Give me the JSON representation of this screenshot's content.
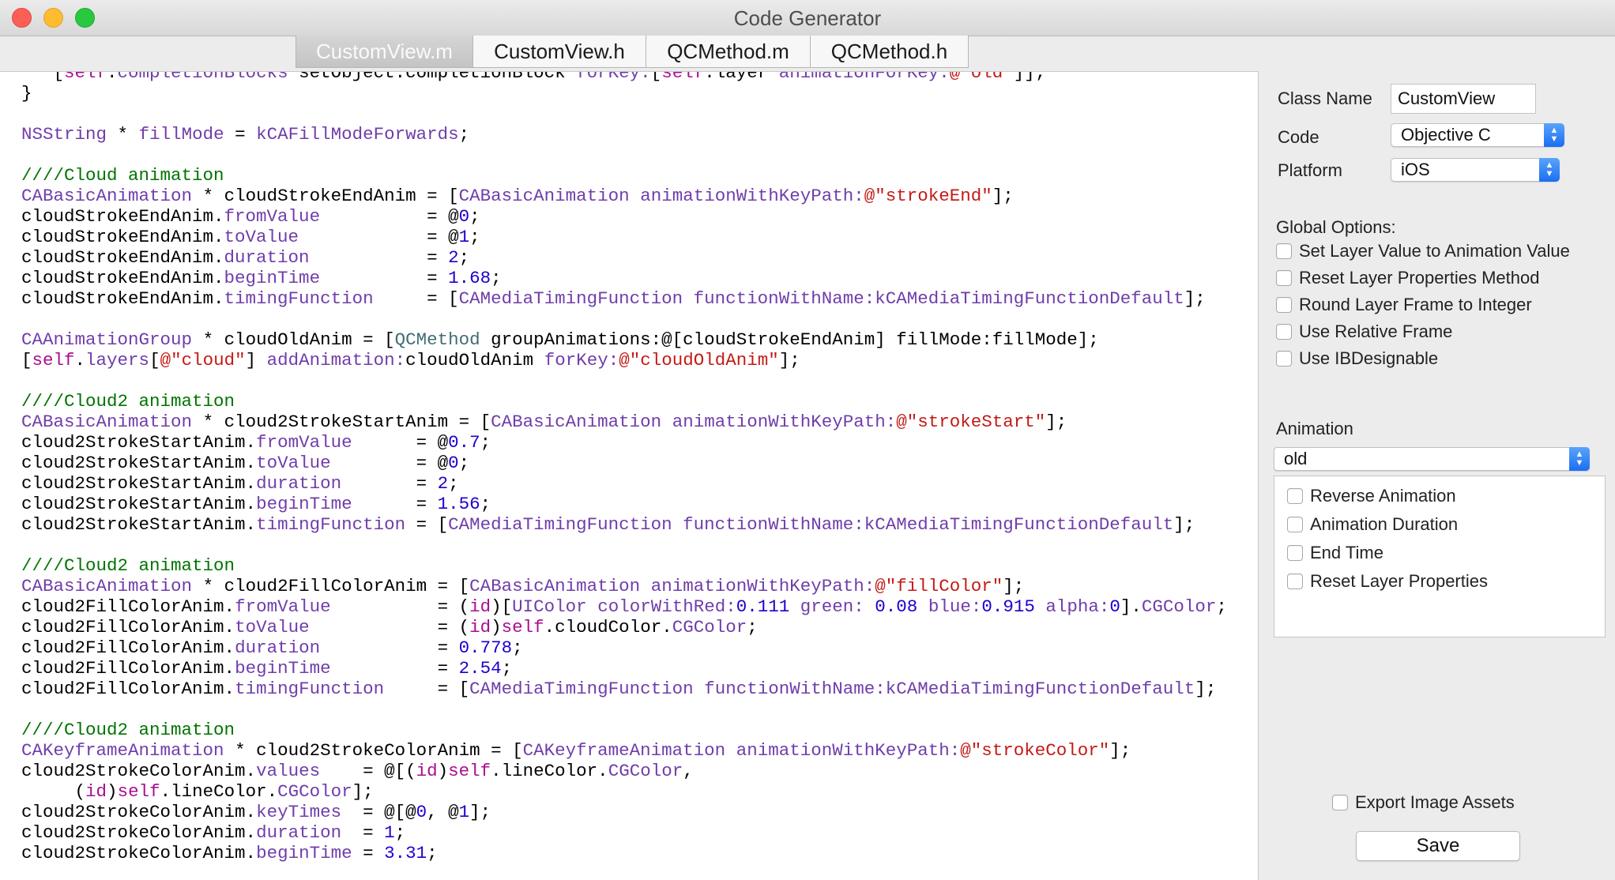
{
  "window": {
    "title": "Code Generator"
  },
  "tabs": [
    {
      "label": "CustomView.m",
      "selected": true
    },
    {
      "label": "CustomView.h",
      "selected": false
    },
    {
      "label": "QCMethod.m",
      "selected": false
    },
    {
      "label": "QCMethod.h",
      "selected": false
    }
  ],
  "code_lines": [
    [
      [
        "pln",
        "     ["
      ],
      [
        "kw",
        "self"
      ],
      [
        "pln",
        "."
      ],
      [
        "prop",
        "completionBlocks"
      ],
      [
        "pln",
        " setObject:completionBlock "
      ],
      [
        "cls",
        "forKey:"
      ],
      [
        "pln",
        "["
      ],
      [
        "kw",
        "self"
      ],
      [
        "pln",
        "."
      ],
      [
        "pln",
        "layer "
      ],
      [
        "cls",
        "animationForKey:"
      ],
      [
        "str",
        "@\"old\""
      ],
      [
        "pln",
        "]];"
      ]
    ],
    [
      [
        "pln",
        "  }"
      ]
    ],
    [
      [
        "pln",
        ""
      ]
    ],
    [
      [
        "pln",
        "  "
      ],
      [
        "cls",
        "NSString"
      ],
      [
        "pln",
        " * "
      ],
      [
        "cls",
        "fillMode"
      ],
      [
        "pln",
        " = "
      ],
      [
        "cls",
        "kCAFillModeForwards"
      ],
      [
        "pln",
        ";"
      ]
    ],
    [
      [
        "pln",
        ""
      ]
    ],
    [
      [
        "pln",
        "  "
      ],
      [
        "cmt",
        "////Cloud animation"
      ]
    ],
    [
      [
        "pln",
        "  "
      ],
      [
        "cls",
        "CABasicAnimation"
      ],
      [
        "pln",
        " * cloudStrokeEndAnim = ["
      ],
      [
        "cls",
        "CABasicAnimation"
      ],
      [
        "pln",
        " "
      ],
      [
        "cls",
        "animationWithKeyPath:"
      ],
      [
        "str",
        "@\"strokeEnd\""
      ],
      [
        "pln",
        "];"
      ]
    ],
    [
      [
        "pln",
        "  cloudStrokeEndAnim."
      ],
      [
        "prop",
        "fromValue"
      ],
      [
        "pln",
        "          = @"
      ],
      [
        "num",
        "0"
      ],
      [
        "pln",
        ";"
      ]
    ],
    [
      [
        "pln",
        "  cloudStrokeEndAnim."
      ],
      [
        "prop",
        "toValue"
      ],
      [
        "pln",
        "            = @"
      ],
      [
        "num",
        "1"
      ],
      [
        "pln",
        ";"
      ]
    ],
    [
      [
        "pln",
        "  cloudStrokeEndAnim."
      ],
      [
        "prop",
        "duration"
      ],
      [
        "pln",
        "           = "
      ],
      [
        "num",
        "2"
      ],
      [
        "pln",
        ";"
      ]
    ],
    [
      [
        "pln",
        "  cloudStrokeEndAnim."
      ],
      [
        "prop",
        "beginTime"
      ],
      [
        "pln",
        "          = "
      ],
      [
        "num",
        "1.68"
      ],
      [
        "pln",
        ";"
      ]
    ],
    [
      [
        "pln",
        "  cloudStrokeEndAnim."
      ],
      [
        "prop",
        "timingFunction"
      ],
      [
        "pln",
        "     = ["
      ],
      [
        "cls",
        "CAMediaTimingFunction"
      ],
      [
        "pln",
        " "
      ],
      [
        "cls",
        "functionWithName:"
      ],
      [
        "cls",
        "kCAMediaTimingFunctionDefault"
      ],
      [
        "pln",
        "];"
      ]
    ],
    [
      [
        "pln",
        ""
      ]
    ],
    [
      [
        "pln",
        "  "
      ],
      [
        "cls",
        "CAAnimationGroup"
      ],
      [
        "pln",
        " * cloudOldAnim = ["
      ],
      [
        "qc",
        "QCMethod"
      ],
      [
        "pln",
        " groupAnimations:@[cloudStrokeEndAnim] fillMode:fillMode];"
      ]
    ],
    [
      [
        "pln",
        "  ["
      ],
      [
        "kw",
        "self"
      ],
      [
        "pln",
        "."
      ],
      [
        "prop",
        "layers"
      ],
      [
        "pln",
        "["
      ],
      [
        "str",
        "@\"cloud\""
      ],
      [
        "pln",
        "] "
      ],
      [
        "cls",
        "addAnimation:"
      ],
      [
        "pln",
        "cloudOldAnim "
      ],
      [
        "cls",
        "forKey:"
      ],
      [
        "str",
        "@\"cloudOldAnim\""
      ],
      [
        "pln",
        "];"
      ]
    ],
    [
      [
        "pln",
        ""
      ]
    ],
    [
      [
        "pln",
        "  "
      ],
      [
        "cmt",
        "////Cloud2 animation"
      ]
    ],
    [
      [
        "pln",
        "  "
      ],
      [
        "cls",
        "CABasicAnimation"
      ],
      [
        "pln",
        " * cloud2StrokeStartAnim = ["
      ],
      [
        "cls",
        "CABasicAnimation"
      ],
      [
        "pln",
        " "
      ],
      [
        "cls",
        "animationWithKeyPath:"
      ],
      [
        "str",
        "@\"strokeStart\""
      ],
      [
        "pln",
        "];"
      ]
    ],
    [
      [
        "pln",
        "  cloud2StrokeStartAnim."
      ],
      [
        "prop",
        "fromValue"
      ],
      [
        "pln",
        "      = @"
      ],
      [
        "num",
        "0.7"
      ],
      [
        "pln",
        ";"
      ]
    ],
    [
      [
        "pln",
        "  cloud2StrokeStartAnim."
      ],
      [
        "prop",
        "toValue"
      ],
      [
        "pln",
        "        = @"
      ],
      [
        "num",
        "0"
      ],
      [
        "pln",
        ";"
      ]
    ],
    [
      [
        "pln",
        "  cloud2StrokeStartAnim."
      ],
      [
        "prop",
        "duration"
      ],
      [
        "pln",
        "       = "
      ],
      [
        "num",
        "2"
      ],
      [
        "pln",
        ";"
      ]
    ],
    [
      [
        "pln",
        "  cloud2StrokeStartAnim."
      ],
      [
        "prop",
        "beginTime"
      ],
      [
        "pln",
        "      = "
      ],
      [
        "num",
        "1.56"
      ],
      [
        "pln",
        ";"
      ]
    ],
    [
      [
        "pln",
        "  cloud2StrokeStartAnim."
      ],
      [
        "prop",
        "timingFunction"
      ],
      [
        "pln",
        " = ["
      ],
      [
        "cls",
        "CAMediaTimingFunction"
      ],
      [
        "pln",
        " "
      ],
      [
        "cls",
        "functionWithName:"
      ],
      [
        "cls",
        "kCAMediaTimingFunctionDefault"
      ],
      [
        "pln",
        "];"
      ]
    ],
    [
      [
        "pln",
        ""
      ]
    ],
    [
      [
        "pln",
        "  "
      ],
      [
        "cmt",
        "////Cloud2 animation"
      ]
    ],
    [
      [
        "pln",
        "  "
      ],
      [
        "cls",
        "CABasicAnimation"
      ],
      [
        "pln",
        " * cloud2FillColorAnim = ["
      ],
      [
        "cls",
        "CABasicAnimation"
      ],
      [
        "pln",
        " "
      ],
      [
        "cls",
        "animationWithKeyPath:"
      ],
      [
        "str",
        "@\"fillColor\""
      ],
      [
        "pln",
        "];"
      ]
    ],
    [
      [
        "pln",
        "  cloud2FillColorAnim."
      ],
      [
        "prop",
        "fromValue"
      ],
      [
        "pln",
        "          = ("
      ],
      [
        "kw",
        "id"
      ],
      [
        "pln",
        ")["
      ],
      [
        "cls",
        "UIColor"
      ],
      [
        "pln",
        " "
      ],
      [
        "cls",
        "colorWithRed:"
      ],
      [
        "num",
        "0.111"
      ],
      [
        "pln",
        " "
      ],
      [
        "cls",
        "green:"
      ],
      [
        "pln",
        " "
      ],
      [
        "num",
        "0.08"
      ],
      [
        "pln",
        " "
      ],
      [
        "cls",
        "blue:"
      ],
      [
        "num",
        "0.915"
      ],
      [
        "pln",
        " "
      ],
      [
        "cls",
        "alpha:"
      ],
      [
        "num",
        "0"
      ],
      [
        "pln",
        "]."
      ],
      [
        "prop",
        "CGColor"
      ],
      [
        "pln",
        ";"
      ]
    ],
    [
      [
        "pln",
        "  cloud2FillColorAnim."
      ],
      [
        "prop",
        "toValue"
      ],
      [
        "pln",
        "            = ("
      ],
      [
        "kw",
        "id"
      ],
      [
        "pln",
        ")"
      ],
      [
        "kw",
        "self"
      ],
      [
        "pln",
        ".cloudColor."
      ],
      [
        "prop",
        "CGColor"
      ],
      [
        "pln",
        ";"
      ]
    ],
    [
      [
        "pln",
        "  cloud2FillColorAnim."
      ],
      [
        "prop",
        "duration"
      ],
      [
        "pln",
        "           = "
      ],
      [
        "num",
        "0.778"
      ],
      [
        "pln",
        ";"
      ]
    ],
    [
      [
        "pln",
        "  cloud2FillColorAnim."
      ],
      [
        "prop",
        "beginTime"
      ],
      [
        "pln",
        "          = "
      ],
      [
        "num",
        "2.54"
      ],
      [
        "pln",
        ";"
      ]
    ],
    [
      [
        "pln",
        "  cloud2FillColorAnim."
      ],
      [
        "prop",
        "timingFunction"
      ],
      [
        "pln",
        "     = ["
      ],
      [
        "cls",
        "CAMediaTimingFunction"
      ],
      [
        "pln",
        " "
      ],
      [
        "cls",
        "functionWithName:"
      ],
      [
        "cls",
        "kCAMediaTimingFunctionDefault"
      ],
      [
        "pln",
        "];"
      ]
    ],
    [
      [
        "pln",
        ""
      ]
    ],
    [
      [
        "pln",
        "  "
      ],
      [
        "cmt",
        "////Cloud2 animation"
      ]
    ],
    [
      [
        "pln",
        "  "
      ],
      [
        "cls",
        "CAKeyframeAnimation"
      ],
      [
        "pln",
        " * cloud2StrokeColorAnim = ["
      ],
      [
        "cls",
        "CAKeyframeAnimation"
      ],
      [
        "pln",
        " "
      ],
      [
        "cls",
        "animationWithKeyPath:"
      ],
      [
        "str",
        "@\"strokeColor\""
      ],
      [
        "pln",
        "];"
      ]
    ],
    [
      [
        "pln",
        "  cloud2StrokeColorAnim."
      ],
      [
        "prop",
        "values"
      ],
      [
        "pln",
        "    = @[("
      ],
      [
        "kw",
        "id"
      ],
      [
        "pln",
        ")"
      ],
      [
        "kw",
        "self"
      ],
      [
        "pln",
        ".lineColor."
      ],
      [
        "prop",
        "CGColor"
      ],
      [
        "pln",
        ","
      ]
    ],
    [
      [
        "pln",
        "       ("
      ],
      [
        "kw",
        "id"
      ],
      [
        "pln",
        ")"
      ],
      [
        "kw",
        "self"
      ],
      [
        "pln",
        ".lineColor."
      ],
      [
        "prop",
        "CGColor"
      ],
      [
        "pln",
        "];"
      ]
    ],
    [
      [
        "pln",
        "  cloud2StrokeColorAnim."
      ],
      [
        "prop",
        "keyTimes"
      ],
      [
        "pln",
        "  = @[@"
      ],
      [
        "num",
        "0"
      ],
      [
        "pln",
        ", @"
      ],
      [
        "num",
        "1"
      ],
      [
        "pln",
        "];"
      ]
    ],
    [
      [
        "pln",
        "  cloud2StrokeColorAnim."
      ],
      [
        "prop",
        "duration"
      ],
      [
        "pln",
        "  = "
      ],
      [
        "num",
        "1"
      ],
      [
        "pln",
        ";"
      ]
    ],
    [
      [
        "pln",
        "  cloud2StrokeColorAnim."
      ],
      [
        "prop",
        "beginTime"
      ],
      [
        "pln",
        " = "
      ],
      [
        "num",
        "3.31"
      ],
      [
        "pln",
        ";"
      ]
    ]
  ],
  "panel": {
    "class_name_label": "Class Name",
    "class_name_value": "CustomView",
    "code_label": "Code",
    "code_value": "Objective C",
    "platform_label": "Platform",
    "platform_value": "iOS",
    "global_options_label": "Global Options:",
    "global_options": [
      {
        "label": "Set Layer Value to Animation Value",
        "checked": false
      },
      {
        "label": "Reset Layer Properties Method",
        "checked": false
      },
      {
        "label": "Round Layer Frame to Integer",
        "checked": false
      },
      {
        "label": "Use Relative Frame",
        "checked": false
      },
      {
        "label": "Use IBDesignable",
        "checked": false
      }
    ],
    "animation_label": "Animation",
    "animation_value": "old",
    "animation_options": [
      {
        "label": "Reverse Animation",
        "checked": false
      },
      {
        "label": "Animation Duration",
        "checked": false
      },
      {
        "label": "End Time",
        "checked": false
      },
      {
        "label": "Reset Layer Properties",
        "checked": false
      }
    ],
    "export_label": "Export Image Assets",
    "export_checked": false,
    "save_label": "Save"
  },
  "colors": {
    "class_purple": "#703daa",
    "keyword_pink": "#aa0d91",
    "number_blue": "#1c00cf",
    "string_red": "#c41a16",
    "comment_green": "#007400",
    "project_teal": "#3f6e74",
    "popup_blue": "#1b6ef2"
  }
}
